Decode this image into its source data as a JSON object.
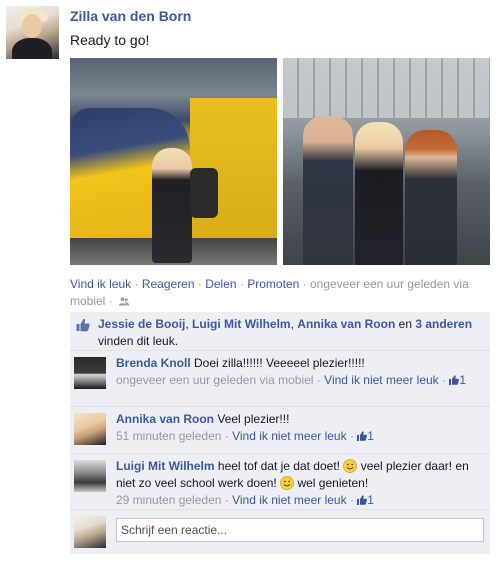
{
  "post": {
    "author": "Zilla van den Born",
    "status": "Ready to go!",
    "actions": {
      "like": "Vind ik leuk",
      "comment": "Reageren",
      "share": "Delen",
      "promote": "Promoten",
      "separator": " · ",
      "timestamp": "ongeveer een uur geleden via mobiel",
      "audience_icon": "people-icon"
    }
  },
  "likes": {
    "names": [
      "Jessie de Booij",
      "Luigi Mit Wilhelm",
      "Annika van Roon"
    ],
    "connector": "en",
    "others_link": "3 anderen",
    "suffix": "vinden dit leuk.",
    "icon": "thumbs-up-icon"
  },
  "comments": [
    {
      "author": "Brenda Knoll",
      "text": "Doei zilla!!!!!! Veeeeel plezier!!!!!",
      "time": "ongeveer een uur geleden via mobiel",
      "unlike": "Vind ik niet meer leuk",
      "likes": "1"
    },
    {
      "author": "Annika van Roon",
      "text": "Veel plezier!!!",
      "time": "51 minuten geleden",
      "unlike": "Vind ik niet meer leuk",
      "likes": "1"
    },
    {
      "author": "Luigi Mit Wilhelm",
      "text_part1": "heel tof dat je dat doet!",
      "text_part2": "veel plezier daar! en niet zo veel school werk doen!",
      "text_part3": "wel genieten!",
      "time": "29 minuten geleden",
      "unlike": "Vind ik niet meer leuk",
      "likes": "1"
    }
  ],
  "reply": {
    "placeholder": "Schrijf een reactie..."
  },
  "colors": {
    "link": "#3b5998",
    "meta": "#9197a3",
    "feedback_bg": "#edeff4"
  }
}
